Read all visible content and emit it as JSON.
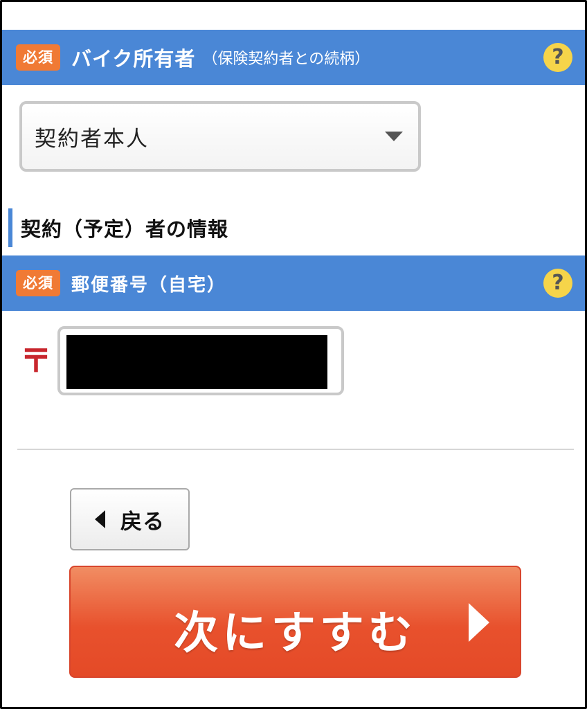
{
  "bike_owner": {
    "required_badge": "必須",
    "title": "バイク所有者",
    "subtitle": "（保険契約者との続柄）",
    "help_icon": "?",
    "select": {
      "selected_value": "契約者本人"
    }
  },
  "contractor_section": {
    "heading": "契約（予定）者の情報"
  },
  "postal_code": {
    "required_badge": "必須",
    "title": "郵便番号（自宅）",
    "help_icon": "?",
    "postal_mark": "〒",
    "value": ""
  },
  "navigation": {
    "back_label": "戻る",
    "next_label": "次にすすむ"
  },
  "colors": {
    "section_bar": "#4a87d6",
    "required_badge": "#f07a35",
    "help_icon": "#f6d44a",
    "postal_mark": "#c8262d",
    "next_button": "#e8512d"
  }
}
